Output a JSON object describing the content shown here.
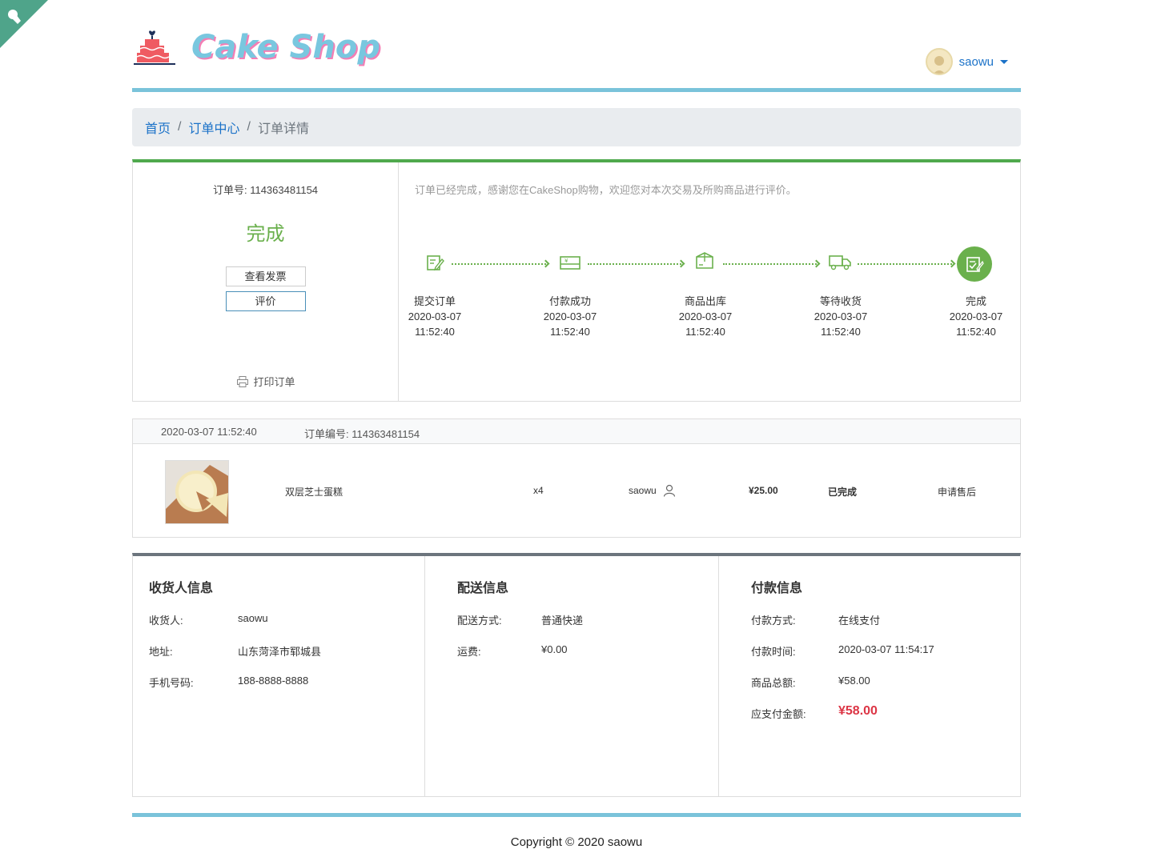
{
  "header": {
    "logo_text": "Cake Shop",
    "username": "saowu"
  },
  "breadcrumb": {
    "home": "首页",
    "orders": "订单中心",
    "current": "订单详情",
    "separator": "/"
  },
  "order_status": {
    "order_no_label": "订单号:",
    "order_no": "114363481154",
    "status": "完成",
    "invoice_button": "查看发票",
    "review_button": "评价",
    "print_label": "打印订单",
    "thanks_message": "订单已经完成，感谢您在CakeShop购物，欢迎您对本次交易及所购商品进行评价。",
    "steps": [
      {
        "label": "提交订单",
        "date": "2020-03-07",
        "time": "11:52:40",
        "icon": "edit-doc-icon"
      },
      {
        "label": "付款成功",
        "date": "2020-03-07",
        "time": "11:52:40",
        "icon": "payment-card-icon"
      },
      {
        "label": "商品出库",
        "date": "2020-03-07",
        "time": "11:52:40",
        "icon": "package-icon"
      },
      {
        "label": "等待收货",
        "date": "2020-03-07",
        "time": "11:52:40",
        "icon": "truck-icon"
      },
      {
        "label": "完成",
        "date": "2020-03-07",
        "time": "11:52:40",
        "icon": "check-doc-icon"
      }
    ]
  },
  "goods": {
    "date": "2020-03-07 11:52:40",
    "order_no_label": "订单编号:",
    "order_no": "114363481154",
    "item": {
      "name": "双层芝士蛋糕",
      "quantity": "x4",
      "buyer": "saowu",
      "price": "¥25.00",
      "status": "已完成",
      "after_sale": "申请售后"
    }
  },
  "receiver": {
    "title": "收货人信息",
    "rows": [
      {
        "label": "收货人:",
        "value": "saowu"
      },
      {
        "label": "地址:",
        "value": "山东菏泽市郓城县"
      },
      {
        "label": "手机号码:",
        "value": "188-8888-8888"
      }
    ]
  },
  "delivery": {
    "title": "配送信息",
    "rows": [
      {
        "label": "配送方式:",
        "value": "普通快递"
      },
      {
        "label": "运费:",
        "value": "¥0.00"
      }
    ]
  },
  "payment": {
    "title": "付款信息",
    "rows": [
      {
        "label": "付款方式:",
        "value": "在线支付"
      },
      {
        "label": "付款时间:",
        "value": "2020-03-07 11:54:17"
      },
      {
        "label": "商品总额:",
        "value": "¥58.00"
      },
      {
        "label": "应支付金额:",
        "value": "¥58.00"
      }
    ]
  },
  "footer": {
    "copyright": "Copyright © 2020 saowu"
  },
  "colors": {
    "accent_blue": "#7ac3da",
    "link_blue": "#1b72c8",
    "success_green": "#6ab04c",
    "price_red": "#dc3545"
  }
}
